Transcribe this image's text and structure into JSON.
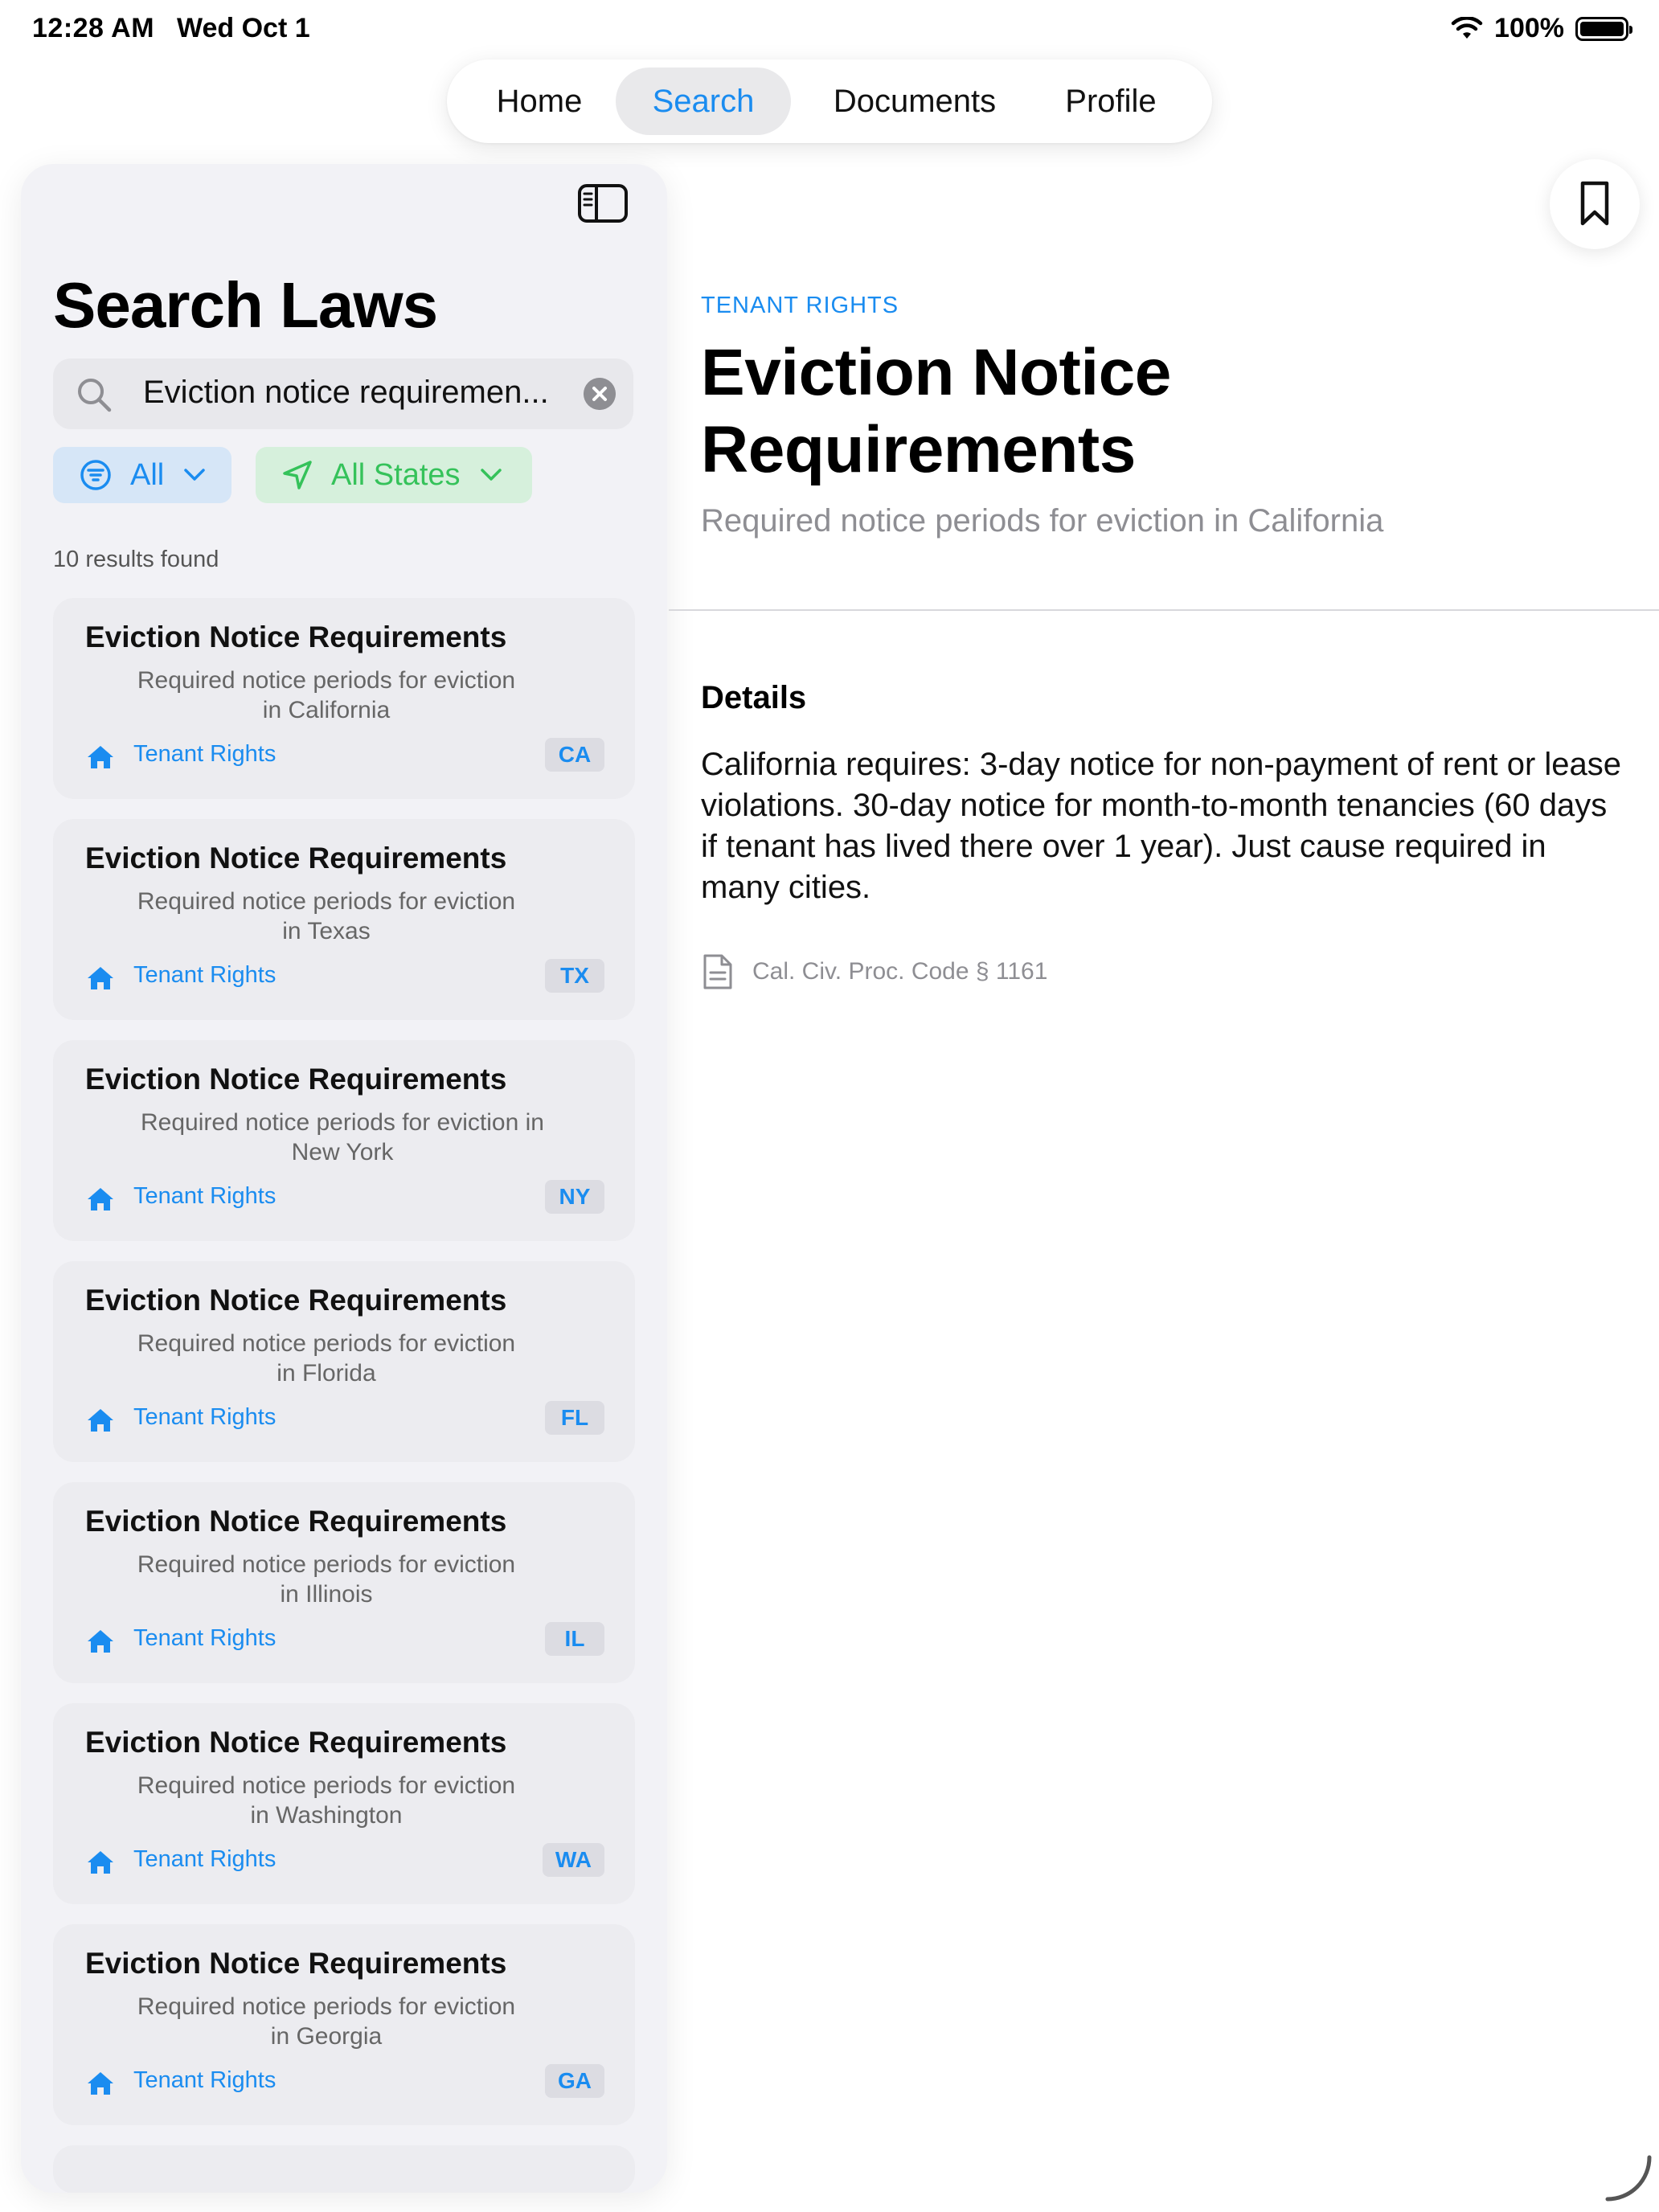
{
  "status_bar": {
    "time": "12:28 AM",
    "date": "Wed Oct 1",
    "battery": "100%"
  },
  "tabs": [
    {
      "label": "Home",
      "active": false
    },
    {
      "label": "Search",
      "active": true
    },
    {
      "label": "Documents",
      "active": false
    },
    {
      "label": "Profile",
      "active": false
    }
  ],
  "sidebar": {
    "title": "Search Laws",
    "search": {
      "value": "Eviction notice requiremen..."
    },
    "filters": {
      "category": "All",
      "state": "All States"
    },
    "results_count": "10 results found",
    "results": [
      {
        "title": "Eviction Notice Requirements",
        "desc_line1": "Required notice periods for eviction",
        "desc_line2": "in California",
        "category": "Tenant Rights",
        "state": "CA"
      },
      {
        "title": "Eviction Notice Requirements",
        "desc_line1": "Required notice periods for eviction",
        "desc_line2": "in Texas",
        "category": "Tenant Rights",
        "state": "TX"
      },
      {
        "title": "Eviction Notice Requirements",
        "desc_line1": "Required notice periods for eviction in",
        "desc_line2": "New York",
        "category": "Tenant Rights",
        "state": "NY"
      },
      {
        "title": "Eviction Notice Requirements",
        "desc_line1": "Required notice periods for eviction",
        "desc_line2": "in Florida",
        "category": "Tenant Rights",
        "state": "FL"
      },
      {
        "title": "Eviction Notice Requirements",
        "desc_line1": "Required notice periods for eviction",
        "desc_line2": "in Illinois",
        "category": "Tenant Rights",
        "state": "IL"
      },
      {
        "title": "Eviction Notice Requirements",
        "desc_line1": "Required notice periods for eviction",
        "desc_line2": "in Washington",
        "category": "Tenant Rights",
        "state": "WA"
      },
      {
        "title": "Eviction Notice Requirements",
        "desc_line1": "Required notice periods for eviction",
        "desc_line2": "in Georgia",
        "category": "Tenant Rights",
        "state": "GA"
      }
    ]
  },
  "detail": {
    "category": "TENANT RIGHTS",
    "title_line1": "Eviction Notice",
    "title_line2": "Requirements",
    "subtitle": "Required notice periods for eviction in California",
    "details_heading": "Details",
    "details_body": "California requires: 3-day notice for non-payment of rent or lease violations. 30-day notice for month-to-month tenancies (60 days if tenant has lived there over 1 year). Just cause required in many cities.",
    "citation": "Cal. Civ. Proc. Code § 1161"
  },
  "colors": {
    "accent": "#1a8cf0",
    "green": "#35c25a",
    "sidebar_bg": "#f2f2f6",
    "card_bg": "#ececf0"
  },
  "icons": [
    "wifi-icon",
    "battery-icon",
    "sidebar-toggle-icon",
    "search-icon",
    "clear-icon",
    "filter-icon",
    "chevron-down-icon",
    "location-arrow-icon",
    "house-icon",
    "bookmark-icon",
    "document-icon"
  ]
}
